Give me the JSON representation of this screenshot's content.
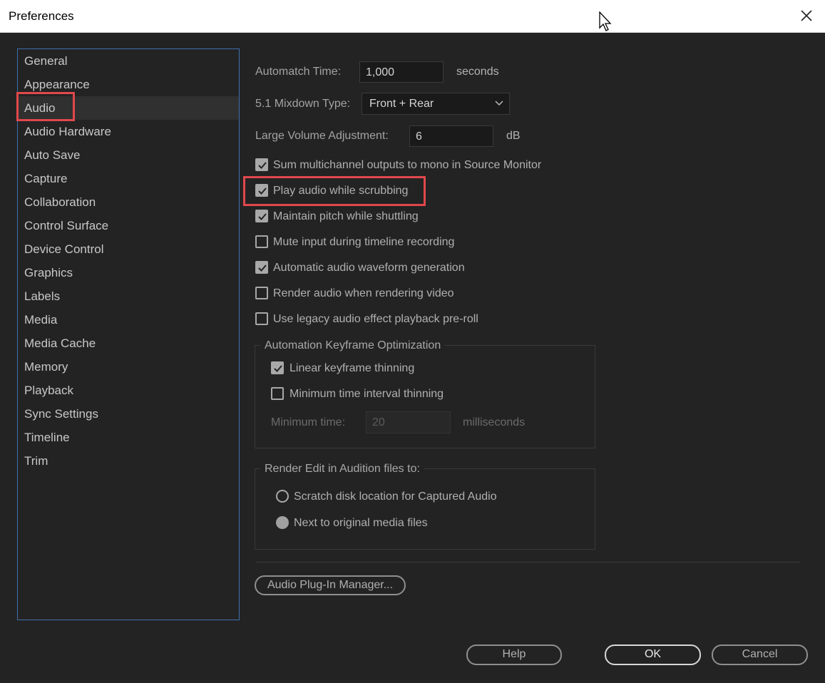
{
  "window": {
    "title": "Preferences"
  },
  "nav": {
    "items": [
      "General",
      "Appearance",
      "Audio",
      "Audio Hardware",
      "Auto Save",
      "Capture",
      "Collaboration",
      "Control Surface",
      "Device Control",
      "Graphics",
      "Labels",
      "Media",
      "Media Cache",
      "Memory",
      "Playback",
      "Sync Settings",
      "Timeline",
      "Trim"
    ],
    "selected": "Audio"
  },
  "audio": {
    "automatch": {
      "label": "Automatch Time:",
      "value": "1,000",
      "unit": "seconds"
    },
    "mixdown": {
      "label": "5.1 Mixdown Type:",
      "value": "Front + Rear"
    },
    "volume": {
      "label": "Large Volume Adjustment:",
      "value": "6",
      "unit": "dB"
    },
    "checkboxes": [
      {
        "label": "Sum multichannel outputs to mono in Source Monitor",
        "checked": true
      },
      {
        "label": "Play audio while scrubbing",
        "checked": true
      },
      {
        "label": "Maintain pitch while shuttling",
        "checked": true
      },
      {
        "label": "Mute input during timeline recording",
        "checked": false
      },
      {
        "label": "Automatic audio waveform generation",
        "checked": true
      },
      {
        "label": "Render audio when rendering video",
        "checked": false
      },
      {
        "label": "Use legacy audio effect playback pre-roll",
        "checked": false
      }
    ],
    "keyframe_group": {
      "title": "Automation Keyframe Optimization",
      "linear": {
        "label": "Linear keyframe thinning",
        "checked": true
      },
      "minimum": {
        "label": "Minimum time interval thinning",
        "checked": false
      },
      "min_time": {
        "label": "Minimum time:",
        "value": "20",
        "unit": "milliseconds"
      }
    },
    "render_group": {
      "title": "Render Edit in Audition files to:",
      "options": [
        {
          "label": "Scratch disk location for Captured Audio",
          "selected": false
        },
        {
          "label": "Next to original media files",
          "selected": true
        }
      ]
    },
    "plugin_button": "Audio Plug-In Manager..."
  },
  "footer": {
    "help": "Help",
    "ok": "OK",
    "cancel": "Cancel"
  },
  "colors": {
    "highlight": "#e0484c",
    "nav_border": "#3f6fae",
    "background": "#232323"
  }
}
